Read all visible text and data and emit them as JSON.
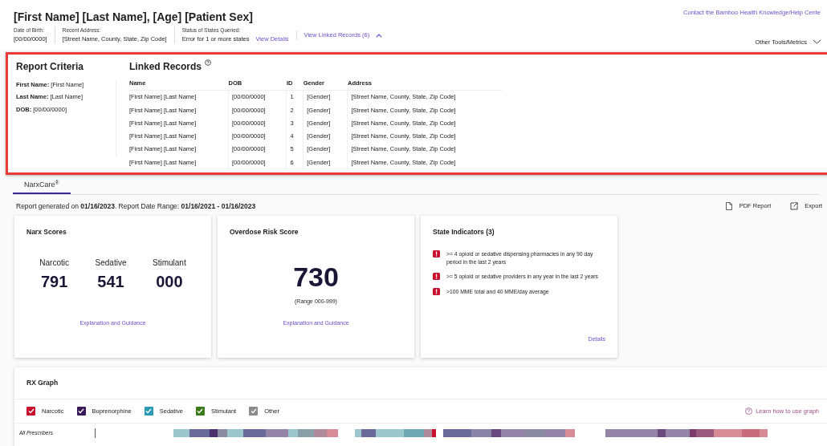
{
  "patient": {
    "title": "[First Name] [Last Name], [Age] [Patient Sex]",
    "fields": [
      {
        "label": "Date of Birth:",
        "value": "[00/00/0000]"
      },
      {
        "label": "Recent Address:",
        "value": "[Street Name, County, State, Zip Code]"
      },
      {
        "label": "Status of States Queried:",
        "value": "Error for 1 or more states",
        "link": "View Details"
      }
    ],
    "linked_link": "View Linked Records (6)",
    "expanded": true,
    "help_link": "Contact the Bamboo Health Knowledge/Help Cente",
    "tools": "Other Tools/Metrics"
  },
  "criteria": {
    "title": "Report Criteria",
    "items": [
      {
        "label": "First Name:",
        "value": "[First Name]"
      },
      {
        "label": "Last Name:",
        "value": "[Last Name]"
      },
      {
        "label": "DOB:",
        "value": "[00/00/0000]"
      }
    ]
  },
  "linked": {
    "title": "Linked Records",
    "columns": [
      "Name",
      "DOB",
      "ID",
      "Gender",
      "Address"
    ],
    "rows": [
      [
        "[First Name] [Last Name]",
        "[00/00/0000]",
        "1",
        "[Gender]",
        "[Street Name, County, State, Zip Code]"
      ],
      [
        "[First Name] [Last Name]",
        "[00/00/0000]",
        "2",
        "[Gender]",
        "[Street Name, County, State, Zip Code]"
      ],
      [
        "[First Name] [Last Name]",
        "[00/00/0000]",
        "3",
        "[Gender]",
        "[Street Name, County, State, Zip Code]"
      ],
      [
        "[First Name] [Last Name]",
        "[00/00/0000]",
        "4",
        "[Gender]",
        "[Street Name, County, State, Zip Code]"
      ],
      [
        "[First Name] [Last Name]",
        "[00/00/0000]",
        "5",
        "[Gender]",
        "[Street Name, County, State, Zip Code]"
      ],
      [
        "[First Name] [Last Name]",
        "[00/00/0000]",
        "6",
        "[Gender]",
        "[Street Name, County, State, Zip Code]"
      ]
    ]
  },
  "tabs": [
    {
      "label": "NarxCare$^{®}$",
      "selected": true
    }
  ],
  "report_line": "Report generated on **01/16/2023**. Report Date Range: **01/16/2021 - 01/16/2023**",
  "actions": [
    "PDF Report",
    "Export"
  ],
  "narx": {
    "title": "Narx Scores",
    "scores": [
      {
        "label": "Narcotic",
        "value": "791"
      },
      {
        "label": "Sedative",
        "value": "541"
      },
      {
        "label": "Stimulant",
        "value": "000"
      }
    ],
    "link": "Explanation and Guidance"
  },
  "overdose": {
    "title": "Overdose Risk Score",
    "value": "730",
    "range": "(Range 000-999)",
    "link": "Explanation and Guidance"
  },
  "indicators": {
    "title": "State Indicators (3)",
    "items": [
      ">= 4 opioid or sedative dispensing pharmacies in any 90 day period in the last 2 years",
      ">= 5 opioid or sedative providers in any year in the last 2 years",
      ">100 MME total and 40 MME/day average"
    ],
    "link": "Details"
  },
  "rx_graph": {
    "title": "RX Graph",
    "legend": [
      {
        "label": "Narcotic",
        "checked": true,
        "color": "#c8102e"
      },
      {
        "label": "Buprenorphine",
        "checked": true,
        "color": "#3b1a5a"
      },
      {
        "label": "Sedative",
        "checked": true,
        "color": "#2a9bb5"
      },
      {
        "label": "Stimulant",
        "checked": true,
        "color": "#3d7a1e"
      },
      {
        "label": "Other",
        "checked": true,
        "color": "#8a8a8a"
      }
    ],
    "help": "Learn how to use graph",
    "row_label": "All Prescribers"
  }
}
